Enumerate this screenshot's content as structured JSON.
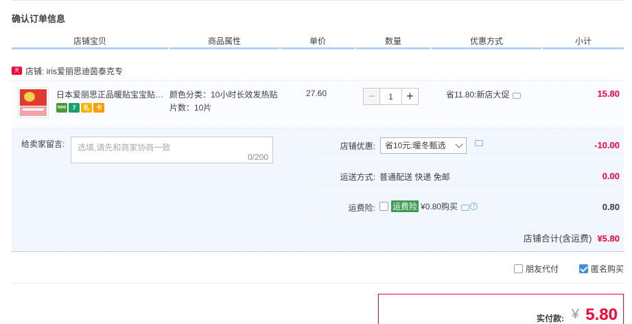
{
  "page_title": "确认订单信息",
  "columns": [
    "店铺宝贝",
    "商品属性",
    "单价",
    "数量",
    "优惠方式",
    "小计"
  ],
  "shop": {
    "badge": "天猫",
    "label": "店铺: iris爱丽思迪茵泰克专"
  },
  "item": {
    "name": "日本爱丽思正品暖贴宝宝贴…",
    "badges": [
      "neo",
      "7",
      "礼",
      "卡"
    ],
    "attr_color": "颜色分类：10小时长效发热贴",
    "attr_count": "片数：10片",
    "unit_price": "27.60",
    "quantity": "1",
    "minus": "−",
    "plus": "+",
    "promotion": "省11.80:新店大促",
    "subtotal": "15.80"
  },
  "order": {
    "message_label": "给卖家留言:",
    "message_placeholder": "选填,请先和商家协商一致",
    "message_count": "0/200",
    "discount_label": "店铺优惠:",
    "discount_option": "省10元:暖冬甄选",
    "discount_value": "-10.00",
    "shipping_label": "运送方式:",
    "shipping_text": "普通配送 快递 免邮",
    "shipping_value": "0.00",
    "insurance_label": "运费险:",
    "insurance_name": "运费险",
    "insurance_text": "¥0.80购买",
    "insurance_help": "?",
    "insurance_value": "0.80",
    "shop_total_label": "店铺合计(含运费)",
    "shop_total_value": "¥5.80"
  },
  "options": {
    "friend_pay": "朋友代付",
    "anonymous": "匿名购买"
  },
  "payment": {
    "label": "实付款:",
    "currency": "¥",
    "amount": "5.80"
  },
  "colors": {
    "accent_red": "#ff0036",
    "header_line": "#b2d1ff",
    "panel_bg": "#f2f7ff"
  }
}
